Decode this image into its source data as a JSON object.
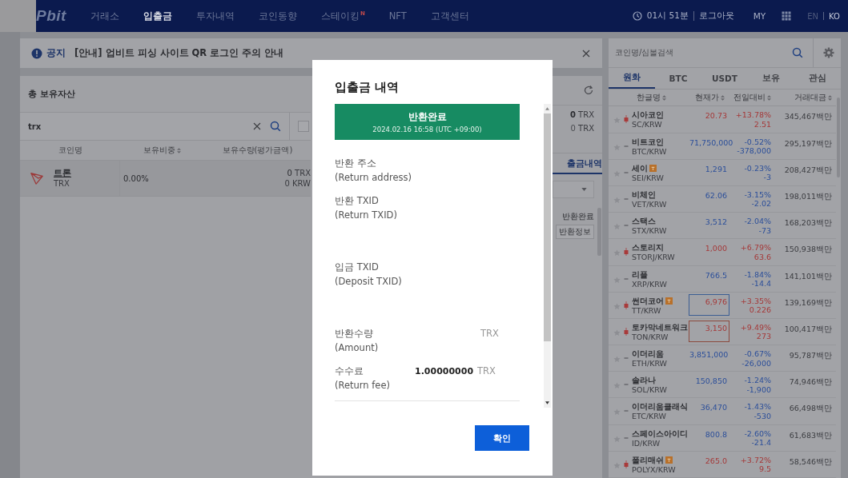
{
  "nav": {
    "logo": "Pbit",
    "items": [
      {
        "label": "거래소",
        "selected": false
      },
      {
        "label": "입출금",
        "selected": true
      },
      {
        "label": "투자내역",
        "selected": false
      },
      {
        "label": "코인동향",
        "selected": false
      },
      {
        "label": "스테이킹",
        "selected": false,
        "badge": "N"
      },
      {
        "label": "NFT",
        "selected": false
      },
      {
        "label": "고객센터",
        "selected": false
      }
    ],
    "clock": "01시 51분",
    "logout": "로그아웃",
    "my": "MY",
    "languages": [
      {
        "label": "EN",
        "selected": false
      },
      {
        "label": "KO",
        "selected": true
      }
    ]
  },
  "notice": {
    "tag": "공지",
    "text": "[안내] 업비트 피싱 사이트 QR 로그인 주의 안내"
  },
  "assets": {
    "title": "총 보유자산",
    "search_value": "trx",
    "checked": false,
    "columns": [
      {
        "label": "코인명",
        "sortable": false
      },
      {
        "label": "보유비중",
        "sortable": true
      },
      {
        "label": "보유수량(평가금액)",
        "sortable": false
      }
    ],
    "rows": [
      {
        "name": "트론",
        "symbol": "TRX",
        "share": "0.00%",
        "amount": "0",
        "amount_unit": "TRX",
        "value": "0",
        "value_unit": "KRW"
      }
    ]
  },
  "side": {
    "balances": [
      {
        "value": "0",
        "unit": "TRX"
      },
      {
        "value": "0",
        "unit": "TRX"
      }
    ],
    "tab": "출금내역",
    "history": [
      {
        "status": "반환완료",
        "action": "반환정보"
      }
    ]
  },
  "market": {
    "search_placeholder": "코인명/심볼검색",
    "tabs": [
      {
        "label": "원화",
        "selected": true
      },
      {
        "label": "BTC",
        "selected": false
      },
      {
        "label": "USDT",
        "selected": false
      },
      {
        "label": "보유",
        "selected": false
      },
      {
        "label": "관심",
        "selected": false
      }
    ],
    "columns": [
      "한글명",
      "현재가",
      "전일대비",
      "거래대금"
    ],
    "rows": [
      {
        "name": "시아코인",
        "symbol": "SC/KRW",
        "caution": false,
        "favorite": false,
        "rising": true,
        "price": "20.73",
        "rate": "+13.78%",
        "change": "2.51",
        "volume": "345,467",
        "unit": "백만"
      },
      {
        "name": "비트코인",
        "symbol": "BTC/KRW",
        "caution": false,
        "favorite": false,
        "rising": false,
        "price": "71,750,000",
        "rate": "-0.52%",
        "change": "-378,000",
        "volume": "295,197",
        "unit": "백만"
      },
      {
        "name": "세이",
        "symbol": "SEI/KRW",
        "caution": true,
        "favorite": false,
        "rising": false,
        "price": "1,291",
        "rate": "-0.23%",
        "change": "-3",
        "volume": "208,427",
        "unit": "백만"
      },
      {
        "name": "비체인",
        "symbol": "VET/KRW",
        "caution": false,
        "favorite": false,
        "rising": false,
        "price": "62.06",
        "rate": "-3.15%",
        "change": "-2.02",
        "volume": "198,011",
        "unit": "백만"
      },
      {
        "name": "스택스",
        "symbol": "STX/KRW",
        "caution": false,
        "favorite": false,
        "rising": false,
        "price": "3,512",
        "rate": "-2.04%",
        "change": "-73",
        "volume": "168,203",
        "unit": "백만"
      },
      {
        "name": "스토리지",
        "symbol": "STORJ/KRW",
        "caution": false,
        "favorite": false,
        "rising": true,
        "price": "1,000",
        "rate": "+6.79%",
        "change": "63.6",
        "volume": "150,938",
        "unit": "백만"
      },
      {
        "name": "리플",
        "symbol": "XRP/KRW",
        "caution": false,
        "favorite": false,
        "rising": false,
        "price": "766.5",
        "rate": "-1.84%",
        "change": "-14.4",
        "volume": "141,101",
        "unit": "백만"
      },
      {
        "name": "썬더코어",
        "symbol": "TT/KRW",
        "caution": true,
        "favorite": false,
        "rising": true,
        "price_box": {
          "color": "#3c5e93"
        },
        "price": "6,976",
        "rate": "+3.35%",
        "change": "0.226",
        "volume": "139,169",
        "unit": "백만"
      },
      {
        "name": "토카막네트워크",
        "symbol": "TON/KRW",
        "caution": false,
        "favorite": false,
        "rising": true,
        "price_box": {
          "color": "#8b4a3e"
        },
        "price": "3,150",
        "rate": "+9.49%",
        "change": "273",
        "volume": "100,417",
        "unit": "백만"
      },
      {
        "name": "이더리움",
        "symbol": "ETH/KRW",
        "caution": false,
        "favorite": false,
        "rising": false,
        "price": "3,851,000",
        "rate": "-0.67%",
        "change": "-26,000",
        "volume": "95,787",
        "unit": "백만"
      },
      {
        "name": "솔라나",
        "symbol": "SOL/KRW",
        "caution": false,
        "favorite": false,
        "rising": false,
        "price": "150,850",
        "rate": "-1.24%",
        "change": "-1,900",
        "volume": "74,946",
        "unit": "백만"
      },
      {
        "name": "이더리움클래식",
        "symbol": "ETC/KRW",
        "caution": false,
        "favorite": false,
        "rising": false,
        "price": "36,470",
        "rate": "-1.43%",
        "change": "-530",
        "volume": "66,498",
        "unit": "백만"
      },
      {
        "name": "스페이스아이디",
        "symbol": "ID/KRW",
        "caution": false,
        "favorite": false,
        "rising": false,
        "price": "800.8",
        "rate": "-2.60%",
        "change": "-21.4",
        "volume": "61,683",
        "unit": "백만"
      },
      {
        "name": "폴리매쉬",
        "symbol": "POLYX/KRW",
        "caution": true,
        "favorite": false,
        "rising": true,
        "price": "265.0",
        "rate": "+3.72%",
        "change": "9.5",
        "volume": "58,546",
        "unit": "백만"
      }
    ]
  },
  "modal": {
    "title": "입출금 내역",
    "status": "반환완료",
    "timestamp": "2024.02.16 16:58 (UTC +09:00)",
    "fields": [
      {
        "kind": "text",
        "label": "반환 주소",
        "label_en": "(Return address)"
      },
      {
        "kind": "txid",
        "label": "반환 TXID",
        "label_en": "(Return TXID)"
      },
      {
        "kind": "txid",
        "label": "입금 TXID",
        "label_en": "(Deposit TXID)"
      },
      {
        "kind": "text",
        "label": "반환수량",
        "label_en": "(Amount)",
        "unit": "TRX"
      },
      {
        "kind": "text",
        "label": "수수료",
        "label_en": "(Return fee)",
        "value": "1.00000000",
        "unit": "TRX"
      }
    ],
    "confirm": "확인"
  }
}
